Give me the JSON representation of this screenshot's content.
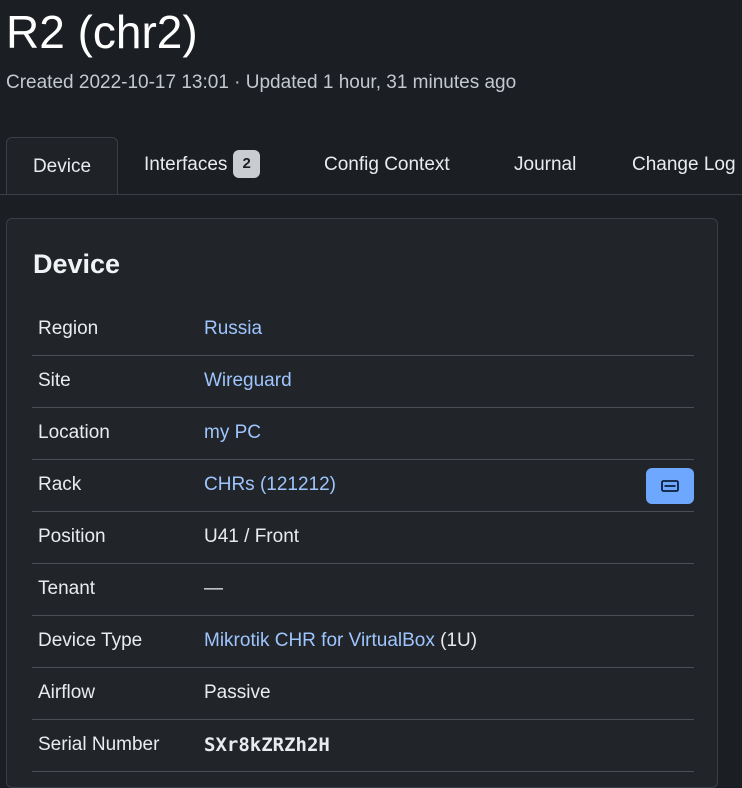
{
  "header": {
    "title": "R2 (chr2)",
    "meta": "Created 2022-10-17 13:01 · Updated 1 hour, 31 minutes ago"
  },
  "tabs": [
    {
      "label": "Device",
      "active": true
    },
    {
      "label": "Interfaces",
      "badge": "2"
    },
    {
      "label": "Config Context"
    },
    {
      "label": "Journal"
    },
    {
      "label": "Change Log"
    }
  ],
  "card": {
    "title": "Device",
    "rows": [
      {
        "label": "Region",
        "value": "Russia"
      },
      {
        "label": "Site",
        "value": "Wireguard"
      },
      {
        "label": "Location",
        "value": "my PC"
      },
      {
        "label": "Rack",
        "value": "CHRs (121212)",
        "button_icon": "rack-icon"
      },
      {
        "label": "Position",
        "value": "U41 / Front"
      },
      {
        "label": "Tenant",
        "value": "—"
      },
      {
        "label": "Device Type",
        "value": "Mikrotik CHR for VirtualBox",
        "suffix": "(1U)"
      },
      {
        "label": "Airflow",
        "value": "Passive"
      },
      {
        "label": "Serial Number",
        "value": "SXr8kZRZh2H"
      }
    ]
  },
  "colors": {
    "background": "#1b1e23",
    "card": "#212429",
    "link": "#9ec5fe",
    "accent_button": "#6ea8fe"
  }
}
